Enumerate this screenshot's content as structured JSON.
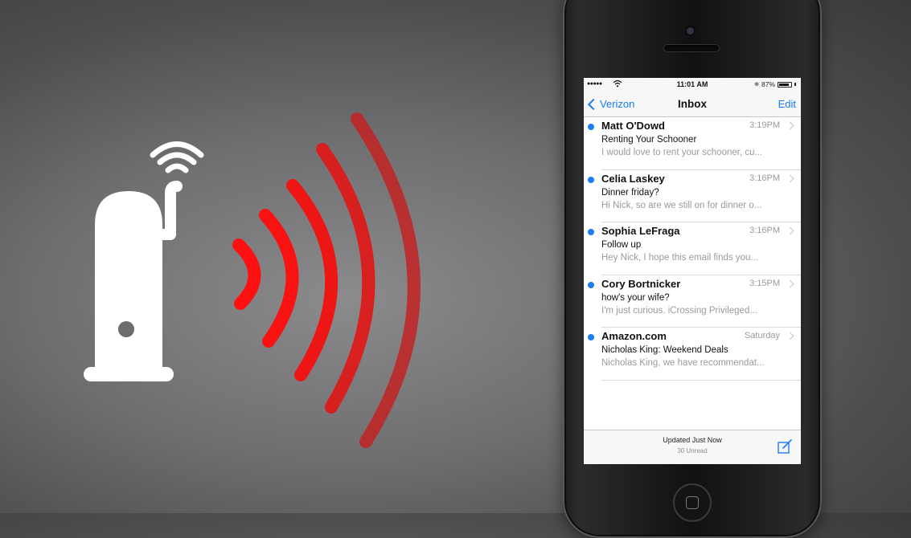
{
  "colors": {
    "signal_waves": "#ff1010",
    "accent": "#1a7cf7",
    "unread_dot": "#1a7cf7"
  },
  "icons": [
    "router-icon",
    "wifi-signal-icon",
    "red-signal-waves",
    "wifi-icon",
    "battery-icon",
    "chevron-left-icon",
    "chevron-right-icon",
    "compose-icon"
  ],
  "status_bar": {
    "time": "11:01 AM",
    "battery_text": "87%",
    "battery_level": 0.87
  },
  "nav": {
    "back_label": "Verizon",
    "title": "Inbox",
    "edit_label": "Edit"
  },
  "messages": [
    {
      "sender": "Matt O'Dowd",
      "time": "3:19PM",
      "subject": "Renting Your Schooner",
      "preview": "I would love to rent your schooner, cu...",
      "unread": true
    },
    {
      "sender": "Celia Laskey",
      "time": "3:16PM",
      "subject": "Dinner friday?",
      "preview": "Hi Nick, so are we still on for dinner o...",
      "unread": true
    },
    {
      "sender": "Sophia LeFraga",
      "time": "3:16PM",
      "subject": "Follow up",
      "preview": "Hey Nick, I hope this email finds you...",
      "unread": true
    },
    {
      "sender": "Cory Bortnicker",
      "time": "3:15PM",
      "subject": "how's your wife?",
      "preview": "I'm just curious. iCrossing Privileged...",
      "unread": true
    },
    {
      "sender": "Amazon.com",
      "time": "Saturday",
      "subject": "Nicholas King: Weekend Deals",
      "preview": "Nicholas King, we have recommendat...",
      "unread": true
    }
  ],
  "toolbar": {
    "updated_label": "Updated Just Now",
    "unread_label": "30 Unread"
  }
}
